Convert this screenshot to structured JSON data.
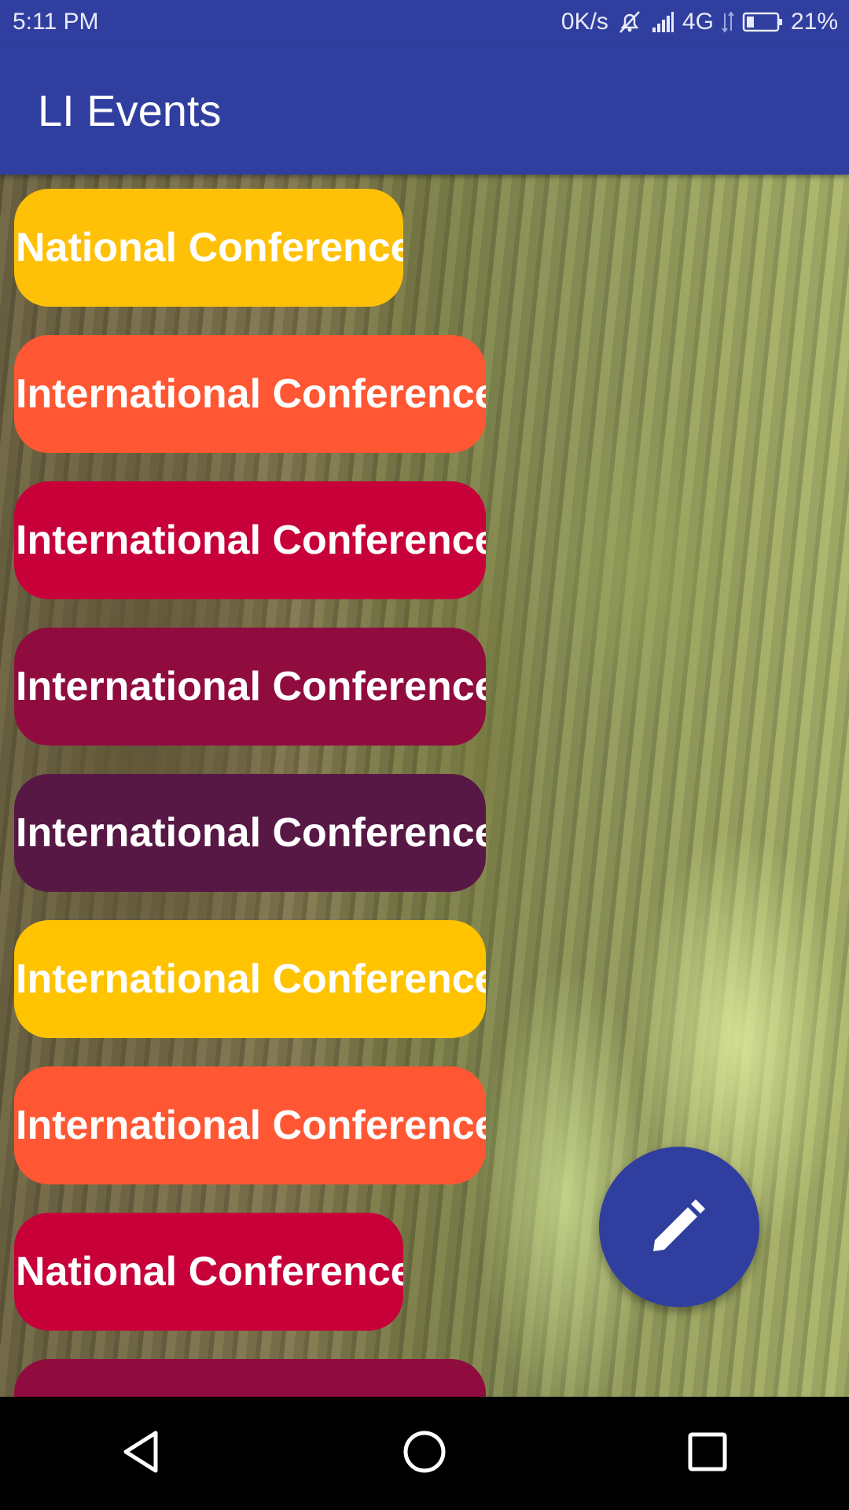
{
  "status_bar": {
    "time": "5:11 PM",
    "network_speed": "0K/s",
    "network_type": "4G",
    "battery": "21%",
    "icons": [
      "alarm-off-icon",
      "signal-icon",
      "data-arrows-icon",
      "battery-icon"
    ]
  },
  "app_bar": {
    "title": "LI Events"
  },
  "events": [
    {
      "label": "National Conference",
      "color": "#FFC107"
    },
    {
      "label": "International Conference",
      "color": "#FF5733"
    },
    {
      "label": "International Conference",
      "color": "#C70039"
    },
    {
      "label": "International Conference",
      "color": "#900C3F"
    },
    {
      "label": "International Conference",
      "color": "#581845"
    },
    {
      "label": "International Conference",
      "color": "#FFC300"
    },
    {
      "label": "International Conference",
      "color": "#FF5733"
    },
    {
      "label": "National Conference",
      "color": "#C70039"
    },
    {
      "label": "",
      "color": "#900C3F"
    }
  ],
  "fab": {
    "icon": "edit-pencil-icon",
    "color": "#303F9F"
  },
  "nav_bar": {
    "buttons": [
      "back-icon",
      "home-icon",
      "recents-icon"
    ]
  },
  "colors": {
    "primary": "#303F9F"
  }
}
